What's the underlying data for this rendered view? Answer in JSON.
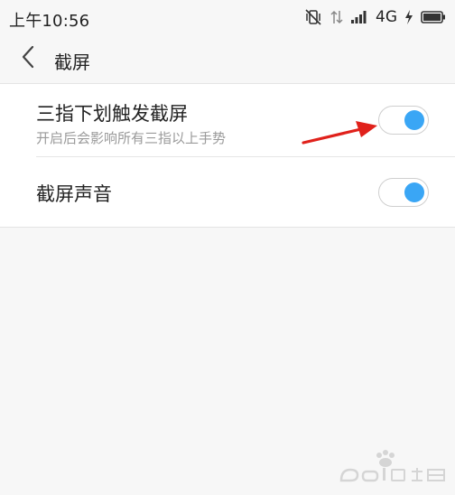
{
  "status_bar": {
    "time": "上午10:56",
    "network": "4G",
    "icons": [
      "vibrate-mute-icon",
      "data-transfer-icon",
      "signal-icon",
      "charging-icon",
      "battery-icon"
    ]
  },
  "title_bar": {
    "back_icon": "chevron-left-icon",
    "title": "截屏"
  },
  "settings": {
    "items": [
      {
        "title": "三指下划触发截屏",
        "description": "开启后会影响所有三指以上手势",
        "enabled": true
      },
      {
        "title": "截屏声音",
        "enabled": true
      }
    ]
  },
  "colors": {
    "toggle_on": "#3aa6f5",
    "annotation_arrow": "#e0211b",
    "background": "#f7f7f7"
  }
}
